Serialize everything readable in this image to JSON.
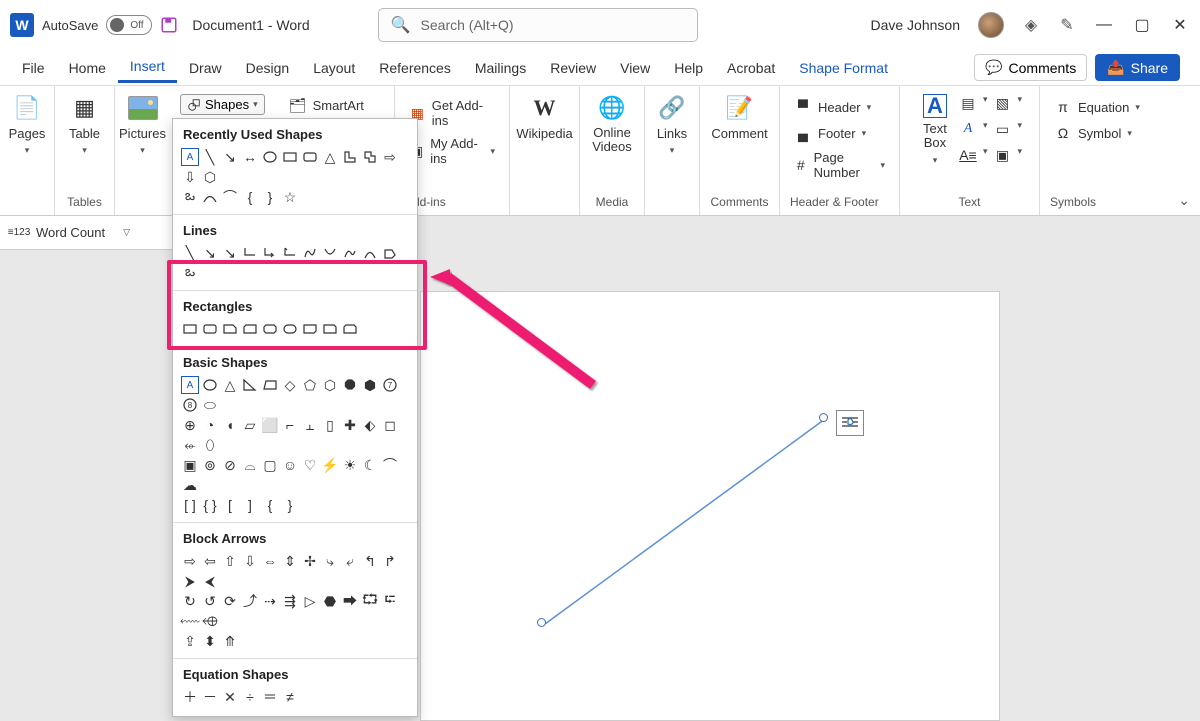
{
  "titlebar": {
    "autosave_label": "AutoSave",
    "autosave_state": "Off",
    "doc_title": "Document1  -  Word",
    "search_placeholder": "Search (Alt+Q)",
    "user_name": "Dave Johnson"
  },
  "menu": {
    "tabs": [
      "File",
      "Home",
      "Insert",
      "Draw",
      "Design",
      "Layout",
      "References",
      "Mailings",
      "Review",
      "View",
      "Help",
      "Acrobat",
      "Shape Format"
    ],
    "active": "Insert",
    "comments": "Comments",
    "share": "Share"
  },
  "ribbon": {
    "pages": "Pages",
    "table": "Table",
    "tables_group": "Tables",
    "pictures": "Pictures",
    "shapes": "Shapes",
    "smartart": "SmartArt",
    "get_addins": "Get Add-ins",
    "my_addins": "My Add-ins",
    "addins_group": "Add-ins",
    "wikipedia": "Wikipedia",
    "online_videos": "Online\nVideos",
    "media_group": "Media",
    "links": "Links",
    "comment": "Comment",
    "comments_group": "Comments",
    "header": "Header",
    "footer": "Footer",
    "page_number": "Page Number",
    "hf_group": "Header & Footer",
    "text_box": "Text\nBox",
    "text_group": "Text",
    "equation": "Equation",
    "symbol": "Symbol",
    "symbols_group": "Symbols"
  },
  "qat": {
    "word_count": "Word Count"
  },
  "shapes_dd": {
    "recent": "Recently Used Shapes",
    "lines": "Lines",
    "rectangles": "Rectangles",
    "basic": "Basic Shapes",
    "block_arrows": "Block Arrows",
    "equation": "Equation Shapes"
  }
}
